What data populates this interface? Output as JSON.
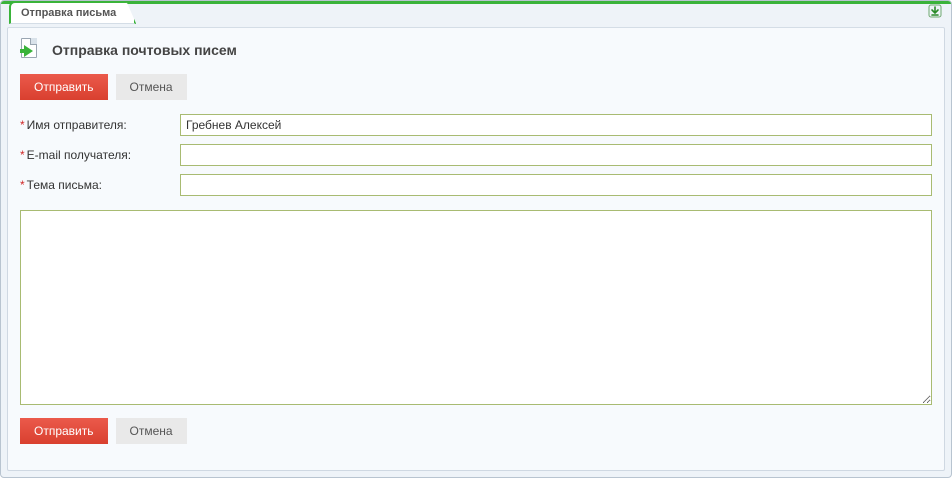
{
  "tab": {
    "label": "Отправка письма"
  },
  "header": {
    "title": "Отправка почтовых писем"
  },
  "buttons": {
    "submit": "Отправить",
    "cancel": "Отмена"
  },
  "form": {
    "sender": {
      "label": "Имя отправителя:",
      "value": "Гребнев Алексей"
    },
    "recipient": {
      "label": "E-mail получателя:",
      "value": ""
    },
    "subject": {
      "label": "Тема письма:",
      "value": ""
    },
    "body": {
      "value": ""
    }
  },
  "required_marker": "*"
}
